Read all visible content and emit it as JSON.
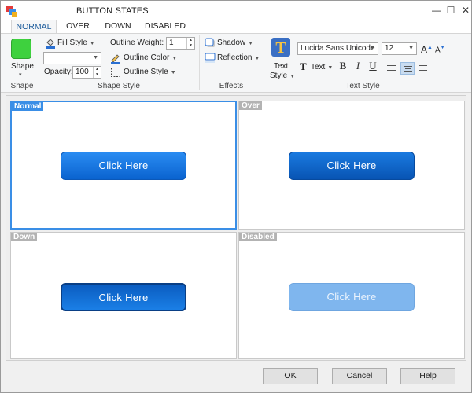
{
  "window": {
    "title": "BUTTON STATES",
    "controls": {
      "minimize": "—",
      "maximize": "☐",
      "close": "✕"
    }
  },
  "tabs": [
    {
      "label": "NORMAL",
      "active": true
    },
    {
      "label": "OVER",
      "active": false
    },
    {
      "label": "DOWN",
      "active": false
    },
    {
      "label": "DISABLED",
      "active": false
    }
  ],
  "ribbon": {
    "shape_group": {
      "button_label": "Shape",
      "group_label": "Shape",
      "swatch_color": "#3ed13e"
    },
    "shape_style_group": {
      "fill_style_label": "Fill Style",
      "fill_combo_value": "",
      "opacity_label": "Opacity:",
      "opacity_value": "100",
      "outline_weight_label": "Outline Weight:",
      "outline_weight_value": "1",
      "outline_color_label": "Outline Color",
      "outline_style_label": "Outline Style",
      "group_label": "Shape Style"
    },
    "effects_group": {
      "shadow_label": "Shadow",
      "reflection_label": "Reflection",
      "group_label": "Effects"
    },
    "text_style_group": {
      "text_style_button_line1": "Text",
      "text_style_button_line2": "Style",
      "font_family_value": "Lucida Sans Unicode",
      "font_size_value": "12",
      "grow_font_label": "A",
      "shrink_font_label": "A",
      "text_dropdown_label": "Text",
      "bold_label": "B",
      "italic_label": "I",
      "underline_label": "U",
      "group_label": "Text Style"
    }
  },
  "panels": [
    {
      "label": "Normal",
      "button_text": "Click Here",
      "selected": true
    },
    {
      "label": "Over",
      "button_text": "Click Here",
      "selected": false
    },
    {
      "label": "Down",
      "button_text": "Click Here",
      "selected": false
    },
    {
      "label": "Disabled",
      "button_text": "Click Here",
      "selected": false
    }
  ],
  "footer": {
    "ok_label": "OK",
    "cancel_label": "Cancel",
    "help_label": "Help"
  },
  "colors": {
    "accent": "#3a8ee6",
    "button_blue": "#0a63cf",
    "disabled_blue": "#7fb6ee"
  }
}
